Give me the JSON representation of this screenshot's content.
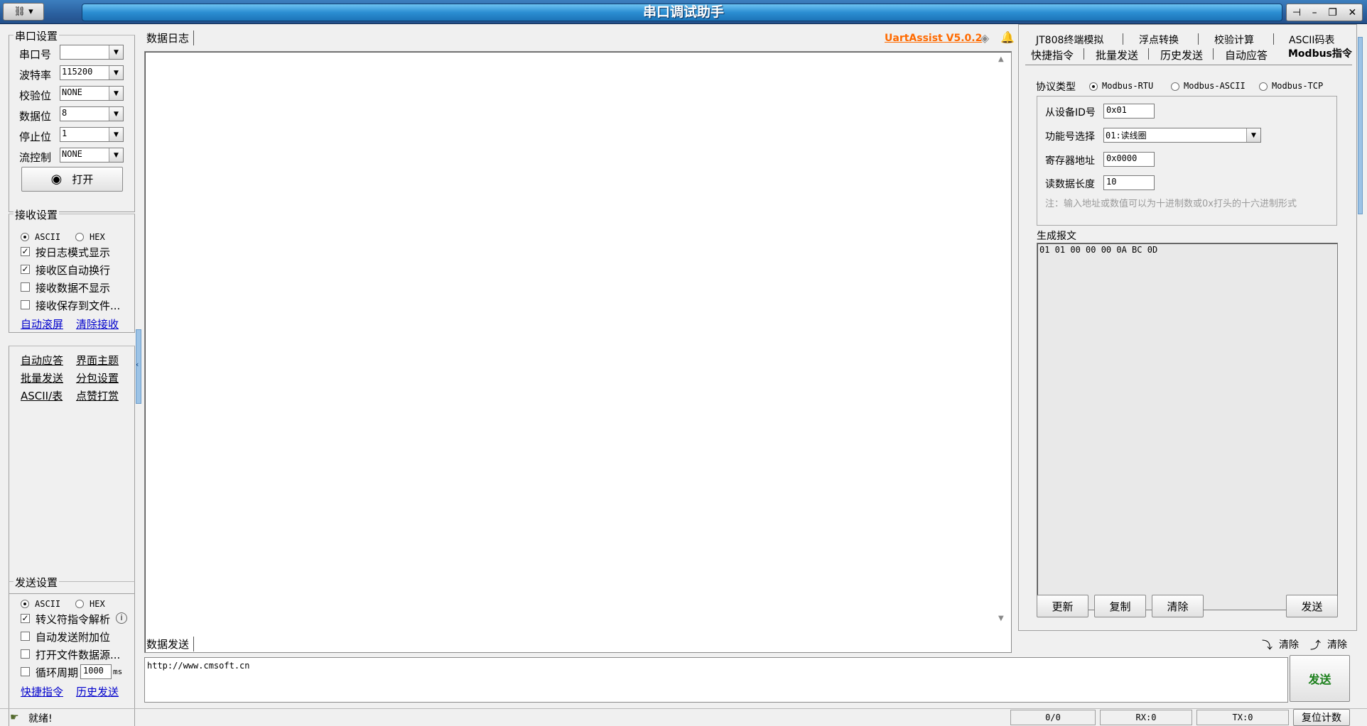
{
  "window": {
    "title": "串口调试助手",
    "sysmenu_icon": "network-icon",
    "controls": [
      "pin",
      "–",
      "restore",
      "×"
    ]
  },
  "serial_settings": {
    "title": "串口设置",
    "port": {
      "label": "串口号",
      "value": ""
    },
    "baud": {
      "label": "波特率",
      "value": "115200"
    },
    "parity": {
      "label": "校验位",
      "value": "NONE"
    },
    "databits": {
      "label": "数据位",
      "value": "8"
    },
    "stopbits": {
      "label": "停止位",
      "value": "1"
    },
    "flow": {
      "label": "流控制",
      "value": "NONE"
    },
    "open_button": "打开"
  },
  "recv_settings": {
    "title": "接收设置",
    "mode_ascii": "ASCII",
    "mode_hex": "HEX",
    "mode_selected": "ASCII",
    "opt_log_mode": {
      "label": "按日志模式显示",
      "checked": true
    },
    "opt_autowrap": {
      "label": "接收区自动换行",
      "checked": true
    },
    "opt_nodisplay": {
      "label": "接收数据不显示",
      "checked": false
    },
    "opt_savefile": {
      "label": "接收保存到文件...",
      "checked": false
    },
    "link_autoscroll": "自动滚屏",
    "link_clear": "清除接收"
  },
  "tools_panel": {
    "auto_reply": "自动应答",
    "ui_theme": "界面主题",
    "batch_send": "批量发送",
    "packet_settings": "分包设置",
    "ascii_table": "ASCII/表",
    "tip": "点赞打赏"
  },
  "send_settings": {
    "title": "发送设置",
    "mode_ascii": "ASCII",
    "mode_hex": "HEX",
    "mode_selected": "ASCII",
    "opt_escape": {
      "label": "转义符指令解析",
      "checked": true
    },
    "opt_appendbit": {
      "label": "自动发送附加位",
      "checked": false
    },
    "opt_filesource": {
      "label": "打开文件数据源...",
      "checked": false
    },
    "opt_loop": {
      "label": "循环周期",
      "checked": false
    },
    "loop_period": "1000",
    "loop_unit": "ms",
    "link_quick": "快捷指令",
    "link_history": "历史发送"
  },
  "log_area": {
    "tab": "数据日志",
    "version": "UartAssist V5.0.2",
    "content": ""
  },
  "send_area": {
    "tab": "数据发送",
    "clear1": "清除",
    "clear2": "清除",
    "content": "http://www.cmsoft.cn",
    "send_button": "发送"
  },
  "right_panel": {
    "tabs_row1": [
      "JT808终端模拟",
      "浮点转换",
      "校验计算",
      "ASCII码表"
    ],
    "tabs_row2": [
      "快捷指令",
      "批量发送",
      "历史发送",
      "自动应答",
      "Modbus指令"
    ],
    "active_tab": "Modbus指令",
    "protocol_label": "协议类型",
    "protocols": [
      "Modbus-RTU",
      "Modbus-ASCII",
      "Modbus-TCP"
    ],
    "protocol_selected": "Modbus-RTU",
    "slave_id": {
      "label": "从设备ID号",
      "value": "0x01"
    },
    "function": {
      "label": "功能号选择",
      "value": "01:读线圈"
    },
    "reg_addr": {
      "label": "寄存器地址",
      "value": "0x0000"
    },
    "read_len": {
      "label": "读数据长度",
      "value": "10"
    },
    "note": "注：输入地址或数值可以为十进制数或0x打头的十六进制形式",
    "generated_label": "生成报文",
    "generated": "01 01 00 00 00 0A BC 0D",
    "btn_update": "更新",
    "btn_copy": "复制",
    "btn_clear": "清除",
    "btn_send": "发送"
  },
  "status_bar": {
    "ready": "就绪!",
    "counter": "0/0",
    "rx": "RX:0",
    "tx": "TX:0",
    "reset": "复位计数"
  }
}
